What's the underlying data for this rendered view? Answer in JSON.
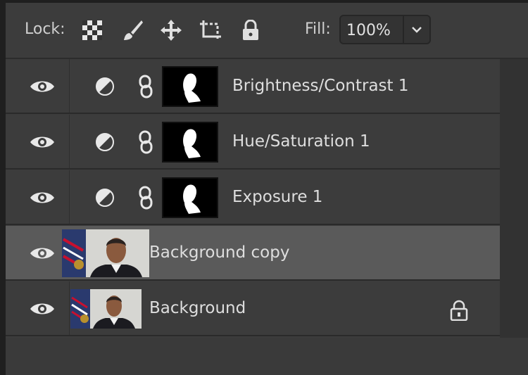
{
  "toolbar": {
    "lock_label": "Lock:",
    "lock_tools": [
      {
        "icon": "transparency-checker-icon"
      },
      {
        "icon": "brush-icon"
      },
      {
        "icon": "move-arrows-icon"
      },
      {
        "icon": "artboard-crop-icon"
      },
      {
        "icon": "padlock-icon"
      }
    ],
    "fill_label": "Fill:",
    "fill_value": "100%"
  },
  "layers": [
    {
      "name": "Brightness/Contrast 1",
      "type": "adjustment",
      "visible": true,
      "selected": false,
      "locked": false
    },
    {
      "name": "Hue/Saturation 1",
      "type": "adjustment",
      "visible": true,
      "selected": false,
      "locked": false
    },
    {
      "name": "Exposure 1",
      "type": "adjustment",
      "visible": true,
      "selected": false,
      "locked": false
    },
    {
      "name": "Background copy",
      "type": "pixel",
      "visible": true,
      "selected": true,
      "locked": false
    },
    {
      "name": "Background",
      "type": "pixel",
      "visible": true,
      "selected": false,
      "locked": true
    }
  ],
  "colors": {
    "panel": "#3c3c3c",
    "selected_row": "#5a5a5a",
    "text": "#dedede"
  }
}
